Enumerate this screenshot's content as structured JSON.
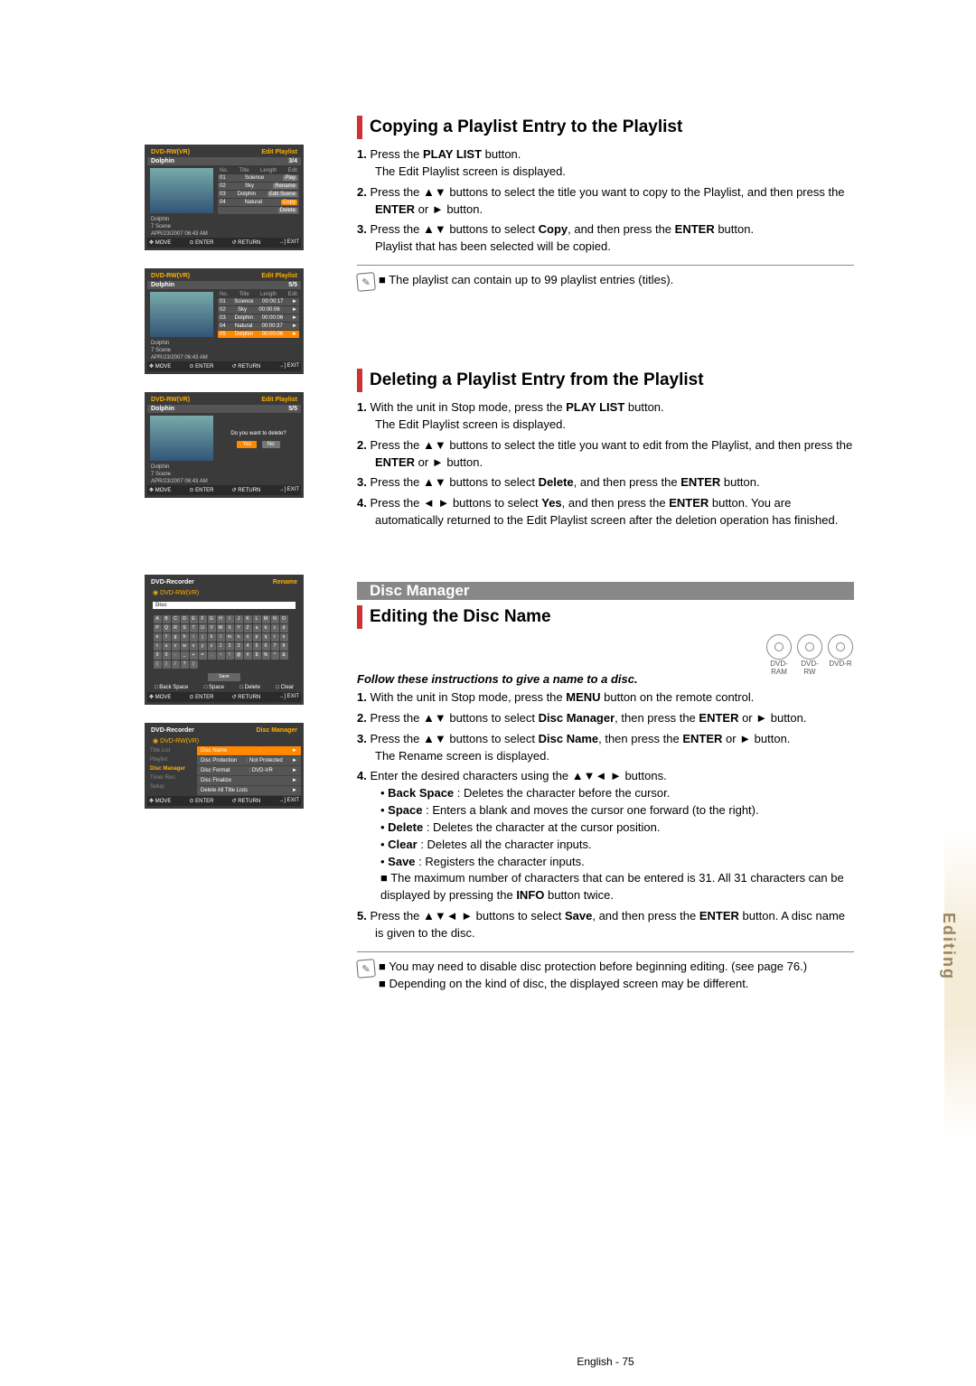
{
  "osd1": {
    "device": "DVD-RW(VR)",
    "mode": "Edit Playlist",
    "name": "Dolphin",
    "counter": "3/4",
    "cols": [
      "No.",
      "Title",
      "Length",
      "Edit"
    ],
    "rows": [
      {
        "no": "01",
        "title": "Science",
        "edit": "Play"
      },
      {
        "no": "02",
        "title": "Sky",
        "edit": "Rename"
      },
      {
        "no": "03",
        "title": "Dolphin",
        "edit": "Edit Scene"
      },
      {
        "no": "04",
        "title": "Natural",
        "edit": "Copy"
      },
      {
        "no": "",
        "title": "",
        "edit": "Delete"
      }
    ],
    "meta": [
      "Dolphin",
      "7 Scene",
      "APR/23/2007 06:43 AM"
    ],
    "ftr": [
      "MOVE",
      "ENTER",
      "RETURN",
      "EXIT"
    ]
  },
  "osd2": {
    "device": "DVD-RW(VR)",
    "mode": "Edit Playlist",
    "name": "Dolphin",
    "counter": "5/5",
    "cols": [
      "No.",
      "Title",
      "Length",
      "Edit"
    ],
    "rows": [
      {
        "no": "01",
        "title": "Science",
        "len": "00:00:17"
      },
      {
        "no": "02",
        "title": "Sky",
        "len": "00:00:06"
      },
      {
        "no": "03",
        "title": "Dolphin",
        "len": "00:00:06"
      },
      {
        "no": "04",
        "title": "Natural",
        "len": "00:00:37"
      },
      {
        "no": "05",
        "title": "Dolphin",
        "len": "00:00:06"
      }
    ],
    "meta": [
      "Dolphin",
      "7 Scene",
      "APR/23/2007 06:43 AM"
    ],
    "ftr": [
      "MOVE",
      "ENTER",
      "RETURN",
      "EXIT"
    ]
  },
  "osd3": {
    "device": "DVD-RW(VR)",
    "mode": "Edit Playlist",
    "name": "Dolphin",
    "counter": "5/5",
    "prompt": "Do you want to delete?",
    "yes": "Yes",
    "no": "No",
    "meta": [
      "Dolphin",
      "7 Scene",
      "APR/23/2007 06:43 AM"
    ],
    "ftr": [
      "MOVE",
      "ENTER",
      "RETURN",
      "EXIT"
    ]
  },
  "kbd": {
    "title": "DVD-Recorder",
    "mode": "Rename",
    "dvd": "DVD-RW(VR)",
    "label": "Disc",
    "keys4": [
      "Back Space",
      "Space",
      "Delete",
      "Clear"
    ],
    "save": "Save",
    "ftr": [
      "MOVE",
      "ENTER",
      "RETURN",
      "EXIT"
    ]
  },
  "dm": {
    "title": "DVD-Recorder",
    "mode": "Disc Manager",
    "dvd": "DVD-RW(VR)",
    "side": [
      "Title List",
      "Playlist",
      "Disc Manager",
      "Timer Rec.",
      "Setup"
    ],
    "rows": [
      {
        "l": "Disc Name",
        "r": ":"
      },
      {
        "l": "Disc Protection",
        "r": ": Not Protected"
      },
      {
        "l": "Disc Format",
        "r": ": DVD-VR"
      },
      {
        "l": "Disc Finalize",
        "r": ""
      },
      {
        "l": "Delete All Title Lists",
        "r": ""
      }
    ],
    "ftr": [
      "MOVE",
      "ENTER",
      "RETURN",
      "EXIT"
    ]
  },
  "sec1": {
    "title": "Copying a Playlist Entry to the Playlist",
    "s1a": "1. ",
    "s1b": "Press the ",
    "s1c": "PLAY LIST",
    "s1d": " button.",
    "s1e": "The Edit Playlist screen is displayed.",
    "s2a": "2. ",
    "s2b": "Press the ▲▼ buttons to select the title you want to copy to the Playlist, and then press the ",
    "s2c": "ENTER",
    "s2d": " or ► button.",
    "s3a": "3. ",
    "s3b": "Press the ▲▼ buttons to select ",
    "s3c": "Copy",
    "s3d": ", and then press the ",
    "s3e": "ENTER",
    "s3f": " button.",
    "s3g": "Playlist that has been selected will be copied.",
    "note": "The playlist can contain up to 99 playlist entries (titles)."
  },
  "sec2": {
    "title": "Deleting a Playlist Entry from the Playlist",
    "s1a": "1. ",
    "s1b": "With the unit in Stop mode, press the ",
    "s1c": "PLAY LIST",
    "s1d": " button.",
    "s1e": "The Edit Playlist screen is displayed.",
    "s2a": "2. ",
    "s2b": "Press the ▲▼ buttons to select the title you want to edit from the Playlist, and then press the ",
    "s2c": "ENTER",
    "s2d": " or ► button.",
    "s3a": "3. ",
    "s3b": "Press the ▲▼ buttons to select ",
    "s3c": "Delete",
    "s3d": ", and then press the ",
    "s3e": "ENTER",
    "s3f": " button.",
    "s4a": "4. ",
    "s4b": "Press the ◄ ► buttons to select ",
    "s4c": "Yes",
    "s4d": ", and then press the ",
    "s4e": "ENTER",
    "s4f": " button. You are automatically returned to the Edit Playlist screen after the deletion operation has finished."
  },
  "banner": "Disc Manager",
  "sec3": {
    "title": "Editing the Disc Name",
    "discs": [
      "DVD-RAM",
      "DVD-RW",
      "DVD-R"
    ],
    "lead": "Follow these instructions to give a name to a disc.",
    "s1a": "1. ",
    "s1b": "With the unit in Stop mode, press the ",
    "s1c": "MENU",
    "s1d": " button on the remote control.",
    "s2a": "2. ",
    "s2b": "Press the ▲▼ buttons to select ",
    "s2c": "Disc Manager",
    "s2d": ", then press the ",
    "s2e": "ENTER",
    "s2f": " or ► button.",
    "s3a": "3. ",
    "s3b": "Press the ▲▼ buttons to select ",
    "s3c": "Disc Name",
    "s3d": ", then press the ",
    "s3e": "ENTER",
    "s3f": " or ► button.",
    "s3g": "The Rename screen is displayed.",
    "s4a": "4. ",
    "s4b": "Enter the desired characters using the ▲▼◄ ► buttons.",
    "b1a": "Back Space",
    "b1b": " : Deletes the character before the cursor.",
    "b2a": "Space",
    "b2b": " : Enters a blank and moves the cursor one forward (to the right).",
    "b3a": "Delete",
    "b3b": " : Deletes the character at the cursor position.",
    "b4a": "Clear",
    "b4b": " : Deletes all the character inputs.",
    "b5a": "Save",
    "b5b": " : Registers the character inputs.",
    "b6": "■ The maximum number of characters that can be entered is 31. All 31 characters can be displayed by pressing the ",
    "b6b": "INFO",
    "b6c": " button twice.",
    "s5a": "5. ",
    "s5b": "Press the ▲▼◄ ► buttons to select ",
    "s5c": "Save",
    "s5d": ", and then press the ",
    "s5e": "ENTER",
    "s5f": " button. A disc name is given to the disc.",
    "n1": "You may need to disable disc protection before beginning editing. (see page 76.)",
    "n2": "Depending on the kind of disc, the displayed screen may be different."
  },
  "sidetab": "Editing",
  "pgno": "English - 75"
}
